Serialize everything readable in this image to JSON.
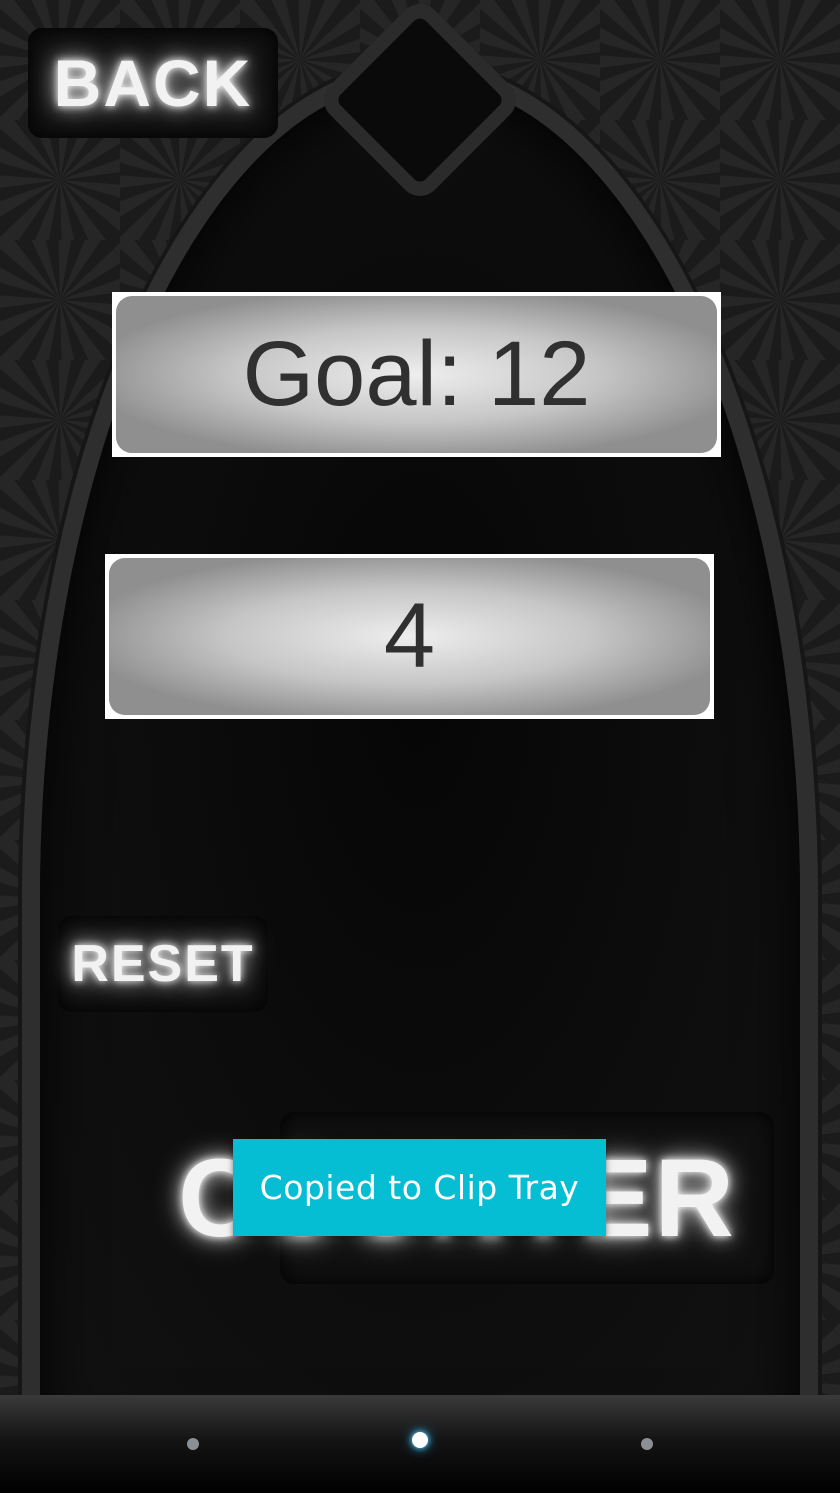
{
  "buttons": {
    "back_label": "BACK",
    "reset_label": "RESET",
    "counter_label": "COUNTER"
  },
  "goal": {
    "text": "Goal: 12"
  },
  "counter": {
    "value": "4"
  },
  "toast": {
    "text": "Copied to Clip Tray"
  },
  "pager": {
    "count": 3,
    "active_index": 1
  },
  "colors": {
    "toast_background": "#06bed3",
    "panel_text": "#303030",
    "button_glow": "#ffffff",
    "background": "#0b0b0b"
  },
  "icons": [
    "page-indicator-dot"
  ]
}
